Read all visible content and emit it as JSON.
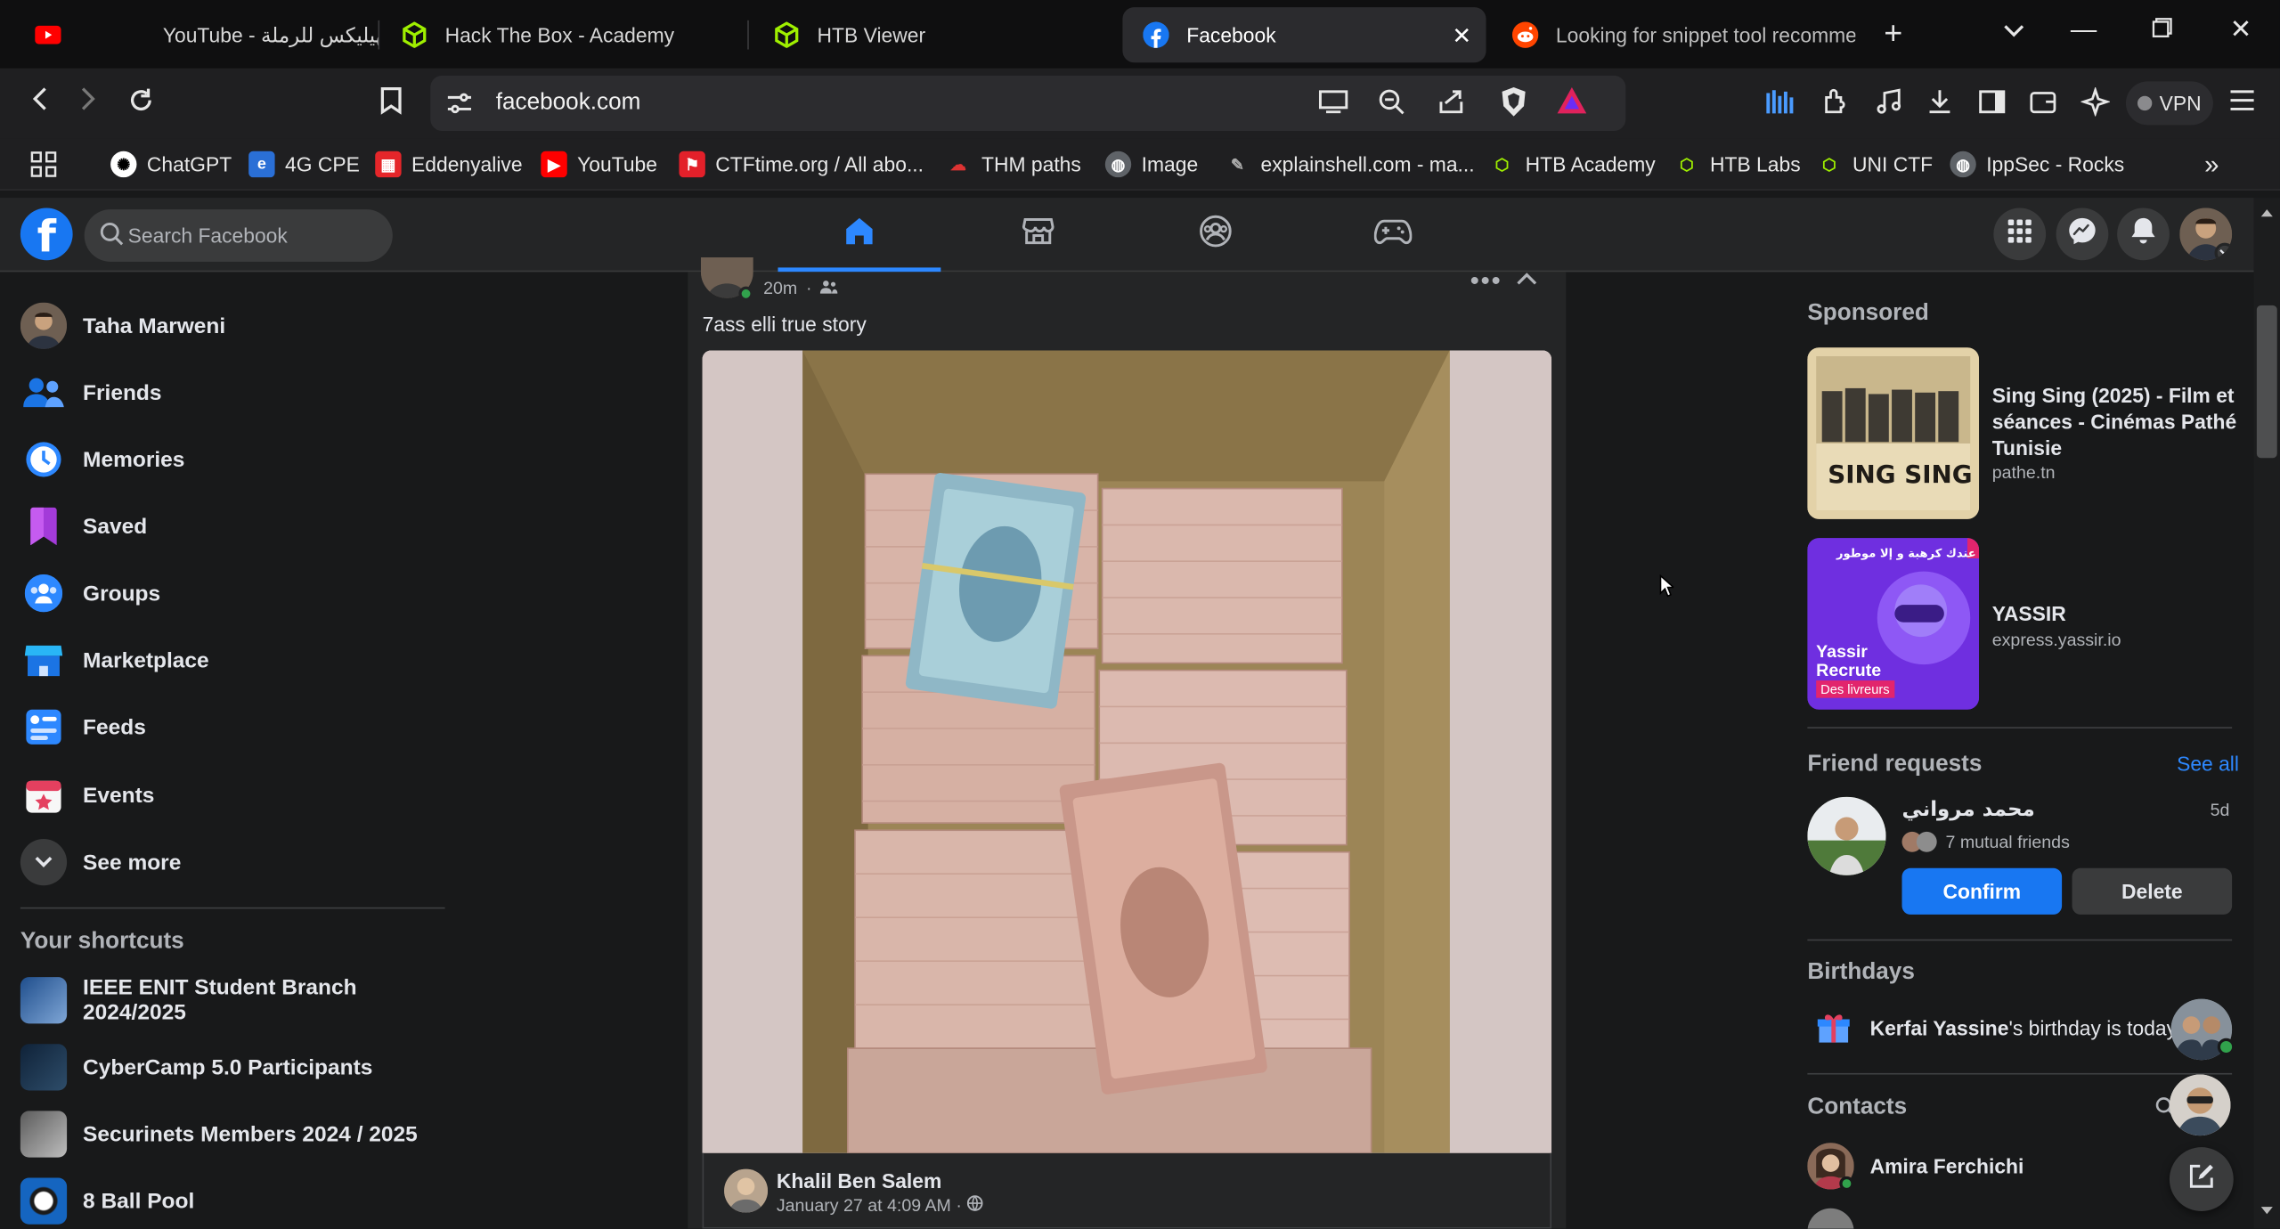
{
  "browser": {
    "tabs": [
      {
        "title": "YouTube - الهيليكس للرملة",
        "icon": "youtube-icon"
      },
      {
        "title": "Hack The Box - Academy",
        "icon": "htb-icon"
      },
      {
        "title": "HTB Viewer",
        "icon": "htb-icon"
      },
      {
        "title": "Facebook",
        "icon": "facebook-icon",
        "active": true
      },
      {
        "title": "Looking for snippet tool recomme",
        "icon": "reddit-icon"
      }
    ],
    "url": "facebook.com",
    "vpn_label": "VPN",
    "bookmarks": [
      "ChatGPT",
      "4G CPE",
      "Eddenyalive",
      "YouTube",
      "CTFtime.org / All abo...",
      "THM paths",
      "Image",
      "explainshell.com - ma...",
      "HTB Academy",
      "HTB Labs",
      "UNI CTF",
      "IppSec - Rocks"
    ]
  },
  "fb": {
    "logo": "f",
    "search_placeholder": "Search Facebook",
    "nav": [
      "home-tab",
      "marketplace-tab",
      "groups-tab",
      "gaming-tab"
    ],
    "accent": "#1877f2"
  },
  "left_nav": [
    {
      "label": "Taha Marweni",
      "icon": "profile-avatar"
    },
    {
      "label": "Friends",
      "icon": "friends-icon"
    },
    {
      "label": "Memories",
      "icon": "memories-icon"
    },
    {
      "label": "Saved",
      "icon": "saved-icon"
    },
    {
      "label": "Groups",
      "icon": "groups-icon"
    },
    {
      "label": "Marketplace",
      "icon": "marketplace-icon"
    },
    {
      "label": "Feeds",
      "icon": "feeds-icon"
    },
    {
      "label": "Events",
      "icon": "events-icon"
    },
    {
      "label": "See more",
      "icon": "chevron-down-icon"
    }
  ],
  "shortcuts": {
    "heading": "Your shortcuts",
    "items": [
      "IEEE ENIT Student Branch 2024/2025",
      "CyberCamp 5.0 Participants",
      "Securinets Members 2024 / 2025",
      "8 Ball Pool"
    ]
  },
  "post": {
    "time": "20m",
    "caption": "7ass elli true story",
    "shared_author": "Khalil Ben Salem",
    "shared_date": "January 27 at 4:09 AM ·"
  },
  "right": {
    "sponsored_heading": "Sponsored",
    "ads": [
      {
        "title": "Sing Sing (2025) - Film et séances - Cinémas Pathé Tunisie",
        "domain": "pathe.tn",
        "image_text": "SING SING"
      },
      {
        "title": "YASSIR",
        "domain": "express.yassir.io",
        "image_text": "Yassir Recrute",
        "image_subtext": "Des livreurs",
        "image_top": "عندك كرهبة و إلا موطور"
      }
    ],
    "friend_requests": {
      "heading": "Friend requests",
      "see_all": "See all",
      "name": "محمد مرواني",
      "age": "5d",
      "mutual": "7 mutual friends",
      "confirm": "Confirm",
      "delete": "Delete"
    },
    "birthdays": {
      "heading": "Birthdays",
      "name": "Kerfai Yassine",
      "text": "'s birthday is today."
    },
    "contacts": {
      "heading": "Contacts",
      "items": [
        "Amira Ferchichi"
      ]
    }
  }
}
